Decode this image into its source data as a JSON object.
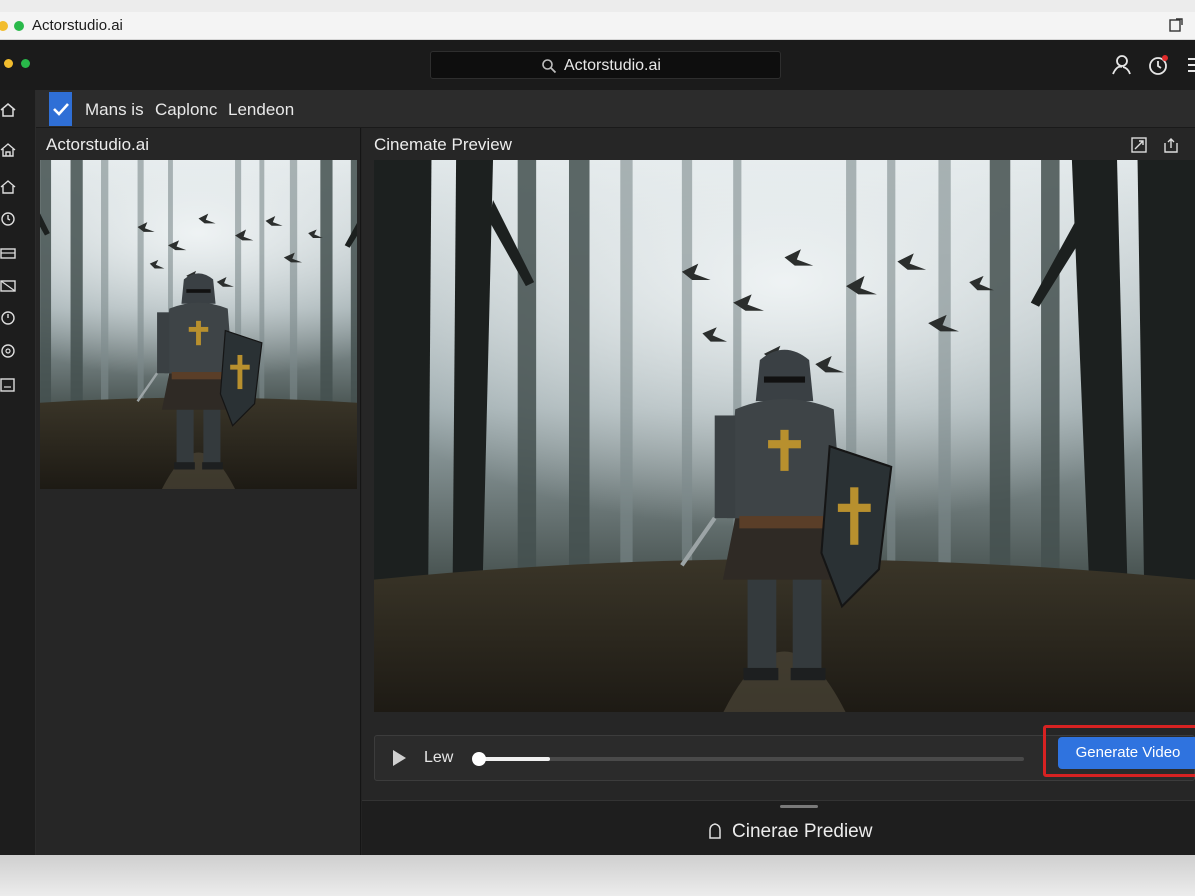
{
  "outer_window": {
    "title": "Actorstudio.ai"
  },
  "app_window": {
    "address": "Actorstudio.ai"
  },
  "menubar": {
    "items": [
      "Mans is",
      "Caplonc",
      "Lendeon"
    ]
  },
  "left_panel": {
    "title": "Actorstudio.ai",
    "thumbnail_icon": "knight-forest-image"
  },
  "main_panel": {
    "title": "Cinemate Preview",
    "icons": [
      "expand-icon",
      "share-icon"
    ],
    "preview_icon": "knight-forest-image"
  },
  "player": {
    "quality_label": "Lew",
    "progress": 0.13,
    "generate_label": "Generate Video"
  },
  "bottom_bar": {
    "label": "Cinerae Prediew"
  },
  "sidebar_icons": [
    "home-icon",
    "house-icon",
    "home-icon",
    "clock-icon",
    "layers-icon",
    "image-icon",
    "clock-icon",
    "record-icon",
    "panel-icon"
  ],
  "colors": {
    "accent": "#2f73df",
    "highlight": "#d72222",
    "app_bg": "#232323"
  }
}
